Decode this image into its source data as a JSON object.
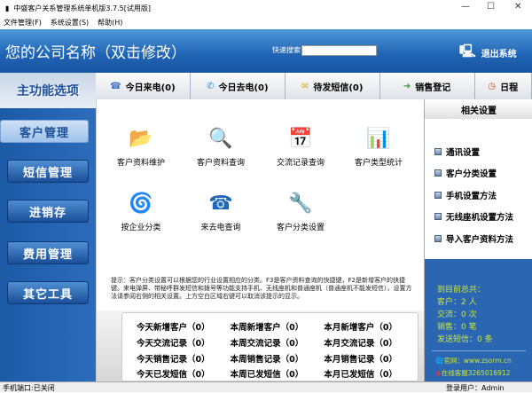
{
  "window": {
    "title": "中盛客户关系管理系统单机版3.7.5[试用版]"
  },
  "menu": [
    "文件管理(F)",
    "系统设置(S)",
    "帮助(H)"
  ],
  "header": {
    "company": "您的公司名称（双击修改）",
    "search_label": "快速搜索",
    "search_value": "",
    "exit": "退出系统"
  },
  "tabs": [
    {
      "label": "今日来电(0)",
      "icon": "phone-icon"
    },
    {
      "label": "今日去电(0)",
      "icon": "handset-icon"
    },
    {
      "label": "待发短信(0)",
      "icon": "envelope-icon"
    },
    {
      "label": "销售登记",
      "icon": "mail-arrow-icon"
    },
    {
      "label": "日程",
      "icon": "calendar-icon"
    }
  ],
  "sidebar": {
    "title": "主功能选项",
    "items": [
      "客户管理",
      "短信管理",
      "进销存",
      "费用管理",
      "其它工具"
    ]
  },
  "main": {
    "icons": [
      {
        "label": "客户资料维护",
        "glyph": "📂"
      },
      {
        "label": "客户资料查询",
        "glyph": "🔍"
      },
      {
        "label": "交流记录查询",
        "glyph": "📅"
      },
      {
        "label": "客户类型统计",
        "glyph": "📊"
      },
      {
        "label": "按企业分类",
        "glyph": "🌀"
      },
      {
        "label": "来去电查询",
        "glyph": "☎"
      },
      {
        "label": "客户分类设置",
        "glyph": "🔧"
      }
    ],
    "hint": "提示：客户分类设置可以根据您的行业设置相应的分类。F3是客户资料查询的快捷键，F2是新增客户的快捷键。来电弹屏、带秘呼群发短信和拨号等功能支持手机、无线座机和普通座机（普通座机不能发短信），设置方法请参阅右侧的相关设置。上方空白区域右键可以取消该提示的显示。",
    "stats": [
      "今天新增客户（0）",
      "本周新增客户（0）",
      "本月新增客户（0）",
      "今天交流记录（0）",
      "本周交流记录（0）",
      "本月交流记录（0）",
      "今天销售记录（0）",
      "本周销售记录（0）",
      "本月销售记录（0）",
      "今天已发短信（0）",
      "本周已发短信（0）",
      "本月已发短信（0）"
    ]
  },
  "right": {
    "title": "相关设置",
    "items": [
      "通讯设置",
      "客户分类设置",
      "手机设置方法",
      "无线座机设置方法",
      "导入客户资料方法"
    ],
    "summary": {
      "heading": "到目前总共：",
      "lines": [
        "客户：2 人",
        "交流：0 次",
        "销售：0 笔",
        "发送短信：0 条"
      ]
    },
    "website": "官网：www.zsorm.cn",
    "support": "在线客服3265016912"
  },
  "status": {
    "port": "手机端口:已关闭",
    "user": "登录用户：Admin"
  }
}
